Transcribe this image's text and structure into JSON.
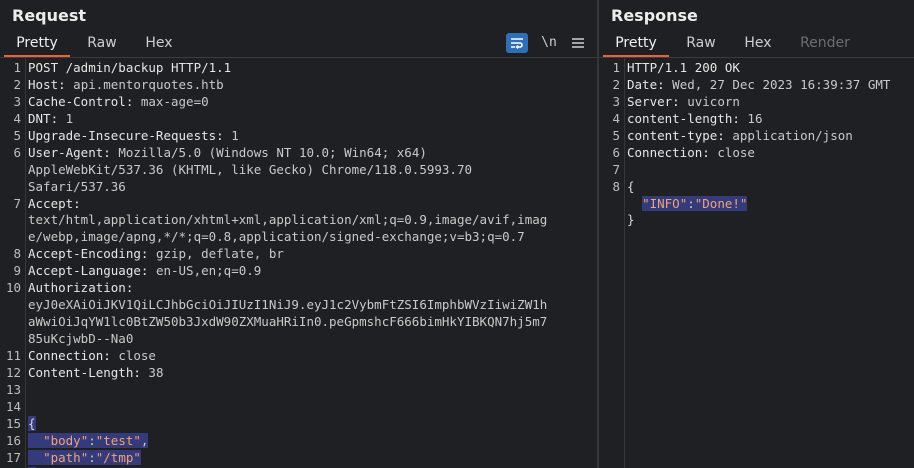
{
  "request": {
    "title": "Request",
    "tabs": [
      "Pretty",
      "Raw",
      "Hex"
    ],
    "active_tab": "Pretty",
    "tools": {
      "wrap_icon": "wrap-lines-icon",
      "newline_label": "\\n",
      "menu_icon": "hamburger-menu-icon"
    },
    "line_numbers": [
      "1",
      "2",
      "3",
      "4",
      "5",
      "6",
      "",
      "",
      "7",
      "",
      "",
      "8",
      "9",
      "10",
      "",
      "",
      "",
      "11",
      "12",
      "13",
      "14",
      "15",
      "16",
      "17"
    ],
    "lines": [
      {
        "key": "POST /admin/backup HTTP/1.1",
        "value": ""
      },
      {
        "key": "Host:",
        "value": " api.mentorquotes.htb"
      },
      {
        "key": "Cache-Control:",
        "value": " max-age=0"
      },
      {
        "key": "DNT:",
        "value": " 1"
      },
      {
        "key": "Upgrade-Insecure-Requests:",
        "value": " 1"
      },
      {
        "key": "User-Agent:",
        "value": " Mozilla/5.0 (Windows NT 10.0; Win64; x64)"
      },
      {
        "key": "",
        "value": "AppleWebKit/537.36 (KHTML, like Gecko) Chrome/118.0.5993.70"
      },
      {
        "key": "",
        "value": "Safari/537.36"
      },
      {
        "key": "Accept:",
        "value": ""
      },
      {
        "key": "",
        "value": "text/html,application/xhtml+xml,application/xml;q=0.9,image/avif,imag"
      },
      {
        "key": "",
        "value": "e/webp,image/apng,*/*;q=0.8,application/signed-exchange;v=b3;q=0.7"
      },
      {
        "key": "Accept-Encoding:",
        "value": " gzip, deflate, br"
      },
      {
        "key": "Accept-Language:",
        "value": " en-US,en;q=0.9"
      },
      {
        "key": "Authorization:",
        "value": ""
      },
      {
        "key": "",
        "value": "eyJ0eXAiOiJKV1QiLCJhbGciOiJIUzI1NiJ9.eyJ1c2VybmFtZSI6ImphbWVzIiwiZW1h"
      },
      {
        "key": "",
        "value": "aWwiOiJqYW1lc0BtZW50b3JxdW90ZXMuaHRiIn0.peGpmshcF666bimHkYIBKQN7hj5m7"
      },
      {
        "key": "",
        "value": "85uKcjwbD--Na0"
      },
      {
        "key": "Connection:",
        "value": " close"
      },
      {
        "key": "Content-Length:",
        "value": " 38"
      },
      {
        "key": "",
        "value": ""
      },
      {
        "key": "",
        "value": ""
      }
    ],
    "body": {
      "open_brace": "{",
      "close_brace": "}",
      "pairs": [
        {
          "key": "\"body\"",
          "colon": ":",
          "value": "\"test\"",
          "comma": ","
        },
        {
          "key": "\"path\"",
          "colon": ":",
          "value": "\"/tmp\"",
          "comma": ""
        }
      ]
    }
  },
  "response": {
    "title": "Response",
    "tabs": [
      "Pretty",
      "Raw",
      "Hex",
      "Render"
    ],
    "active_tab": "Pretty",
    "line_numbers": [
      "1",
      "2",
      "3",
      "4",
      "5",
      "6",
      "7",
      "8"
    ],
    "lines": [
      {
        "key": "HTTP/1.1 200 OK",
        "value": ""
      },
      {
        "key": "Date:",
        "value": " Wed, 27 Dec 2023 16:39:37 GMT"
      },
      {
        "key": "Server:",
        "value": " uvicorn"
      },
      {
        "key": "content-length:",
        "value": " 16"
      },
      {
        "key": "content-type:",
        "value": " application/json"
      },
      {
        "key": "Connection:",
        "value": " close"
      },
      {
        "key": "",
        "value": ""
      }
    ],
    "body": {
      "open_brace": "{",
      "close_brace": "}",
      "key": "\"INFO\"",
      "colon": ":",
      "value": "\"Done!\""
    }
  },
  "colors": {
    "accent": "#e8623a",
    "background": "#1f2023",
    "selection": "#343a7a",
    "json_string": "#f0a477",
    "tool_active": "#2e6fb5"
  }
}
